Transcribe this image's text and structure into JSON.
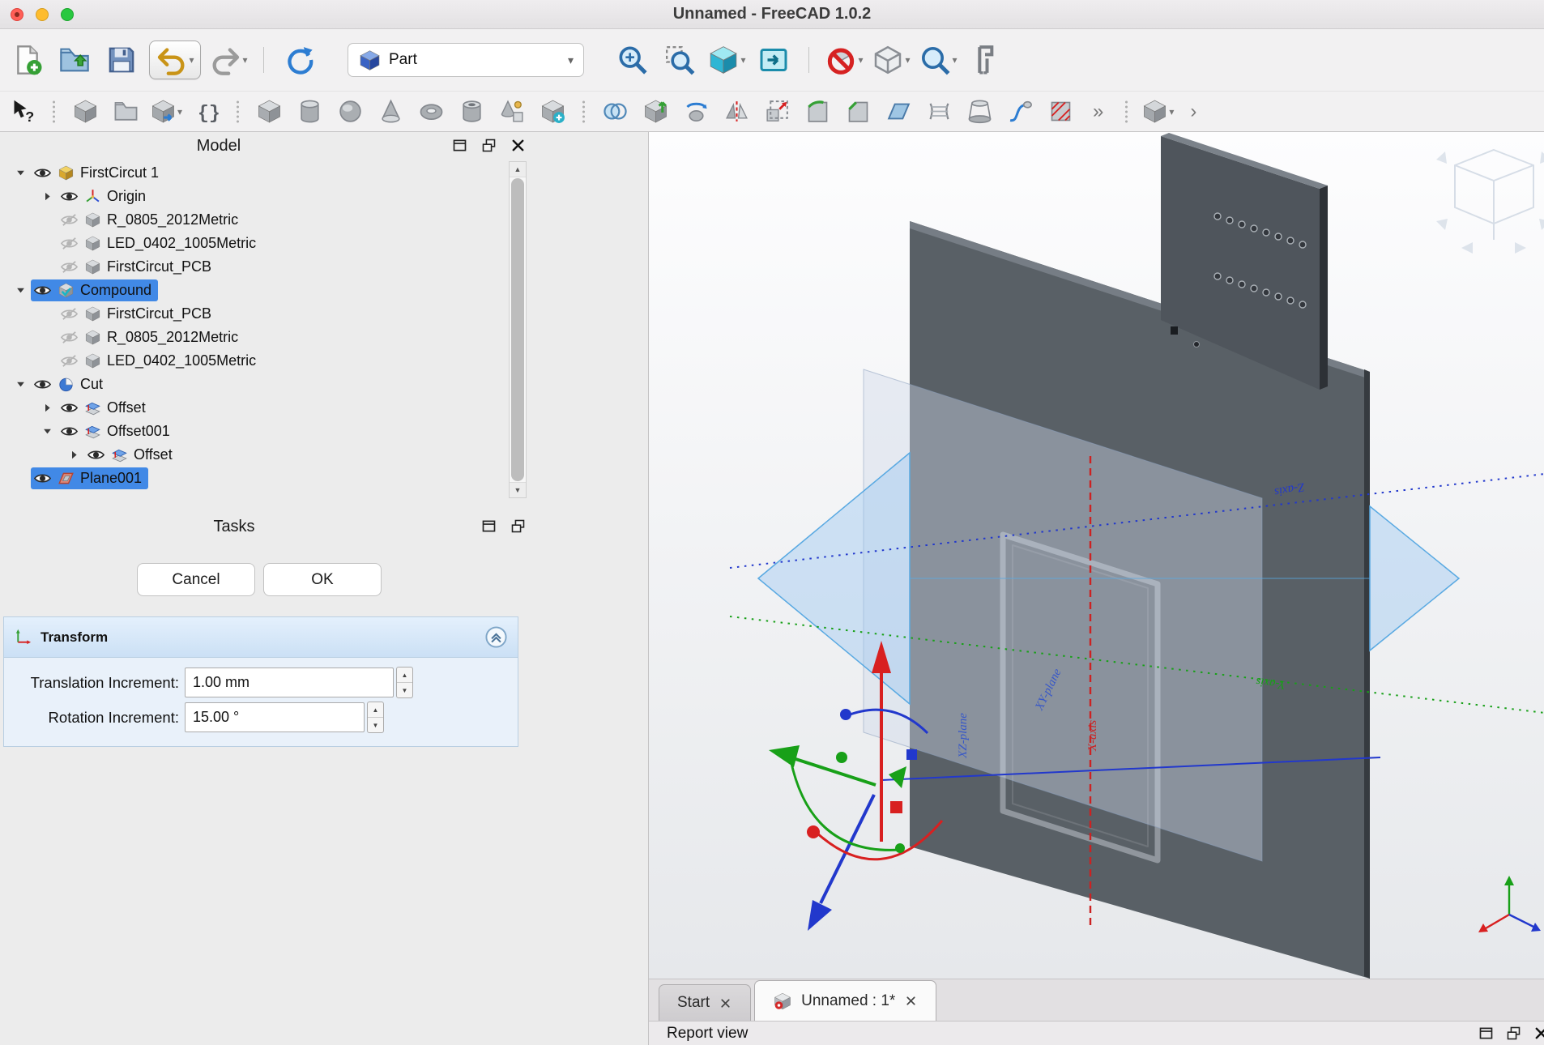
{
  "window": {
    "title": "Unnamed - FreeCAD 1.0.2"
  },
  "colors": {
    "selection_highlight": "#4189e6",
    "task_header": "#cbe0f5"
  },
  "toolbars": {
    "row1_left": [
      {
        "icon": "new-document"
      },
      {
        "icon": "open-file"
      },
      {
        "icon": "save"
      },
      {
        "icon": "undo",
        "boxed": true,
        "arrow": true
      },
      {
        "icon": "redo",
        "arrow": true
      },
      {
        "sep": true
      },
      {
        "icon": "refresh"
      }
    ],
    "workbench": {
      "value": "Part",
      "icon": "part-workbench"
    },
    "row1_right": [
      {
        "icon": "zoom-fit"
      },
      {
        "icon": "zoom-selection"
      },
      {
        "icon": "axonometric-view",
        "arrow": true
      },
      {
        "icon": "sync-view"
      },
      {
        "sep": true
      },
      {
        "icon": "clipping-plane",
        "arrow": true
      },
      {
        "icon": "view-cube",
        "arrow": true
      },
      {
        "icon": "zoom-tools",
        "arrow": true
      },
      {
        "icon": "measure"
      }
    ],
    "row2": [
      {
        "icon": "whats-this"
      },
      {
        "handle": true
      },
      {
        "icon": "import-part"
      },
      {
        "icon": "group-folder"
      },
      {
        "icon": "export-part",
        "arrow": true
      },
      {
        "icon": "expressions"
      },
      {
        "handle": true
      },
      {
        "icon": "primitive-box"
      },
      {
        "icon": "primitive-cylinder"
      },
      {
        "icon": "primitive-sphere"
      },
      {
        "icon": "primitive-cone"
      },
      {
        "icon": "primitive-torus"
      },
      {
        "icon": "primitive-tube"
      },
      {
        "icon": "primitives-dialog"
      },
      {
        "icon": "shape-builder"
      },
      {
        "handle": true
      },
      {
        "icon": "boolean-operation"
      },
      {
        "icon": "extrude"
      },
      {
        "icon": "revolve"
      },
      {
        "icon": "mirror"
      },
      {
        "icon": "scale"
      },
      {
        "icon": "fillet"
      },
      {
        "icon": "chamfer"
      },
      {
        "icon": "make-face"
      },
      {
        "icon": "ruled-surface"
      },
      {
        "icon": "loft"
      },
      {
        "icon": "sweep"
      },
      {
        "icon": "cross-section"
      },
      {
        "overflow": "»"
      },
      {
        "handle": true
      },
      {
        "icon": "view-group",
        "arrow": true
      },
      {
        "overflow": "›"
      }
    ]
  },
  "model_panel": {
    "title": "Model",
    "tree": [
      {
        "label": "FirstCircut 1",
        "indent": 0,
        "expand": "open",
        "visible": true,
        "icon": "document"
      },
      {
        "label": "Origin",
        "indent": 1,
        "expand": "closed",
        "visible": true,
        "icon": "origin"
      },
      {
        "label": "R_0805_2012Metric",
        "indent": 1,
        "visible": false,
        "icon": "part"
      },
      {
        "label": "LED_0402_1005Metric",
        "indent": 1,
        "visible": false,
        "icon": "part"
      },
      {
        "label": "FirstCircut_PCB",
        "indent": 1,
        "visible": false,
        "icon": "part"
      },
      {
        "label": "Compound",
        "indent": 0,
        "expand": "open",
        "visible": true,
        "icon": "compound",
        "selected": true
      },
      {
        "label": "FirstCircut_PCB",
        "indent": 1,
        "visible": false,
        "icon": "part"
      },
      {
        "label": "R_0805_2012Metric",
        "indent": 1,
        "visible": false,
        "icon": "part"
      },
      {
        "label": "LED_0402_1005Metric",
        "indent": 1,
        "visible": false,
        "icon": "part"
      },
      {
        "label": "Cut",
        "indent": 0,
        "expand": "open",
        "visible": true,
        "icon": "cut"
      },
      {
        "label": "Offset",
        "indent": 1,
        "expand": "closed",
        "visible": true,
        "icon": "offset"
      },
      {
        "label": "Offset001",
        "indent": 1,
        "expand": "open",
        "visible": true,
        "icon": "offset"
      },
      {
        "label": "Offset",
        "indent": 2,
        "expand": "closed",
        "visible": true,
        "icon": "offset"
      },
      {
        "label": "Plane001",
        "indent": 0,
        "visible": true,
        "icon": "plane",
        "selected": true
      }
    ]
  },
  "tasks_panel": {
    "title": "Tasks",
    "cancel": "Cancel",
    "ok": "OK",
    "transform": {
      "title": "Transform",
      "rows": [
        {
          "label": "Translation Increment:",
          "value": "1.00 mm"
        },
        {
          "label": "Rotation Increment:",
          "value": "15.00 °"
        }
      ]
    }
  },
  "viewport": {
    "labels": {
      "axis_right_blue": "Z-axis",
      "axis_lower_green": "Y-axis",
      "axis_vertical_red": "X-axis",
      "plane_vertical": "XZ-plane",
      "plane_diagonal": "XY-plane"
    }
  },
  "tab_bar": {
    "tabs": [
      {
        "label": "Start",
        "active": false
      },
      {
        "label": "Unnamed : 1*",
        "active": true
      }
    ]
  },
  "status_bar": {
    "title": "Report view"
  }
}
